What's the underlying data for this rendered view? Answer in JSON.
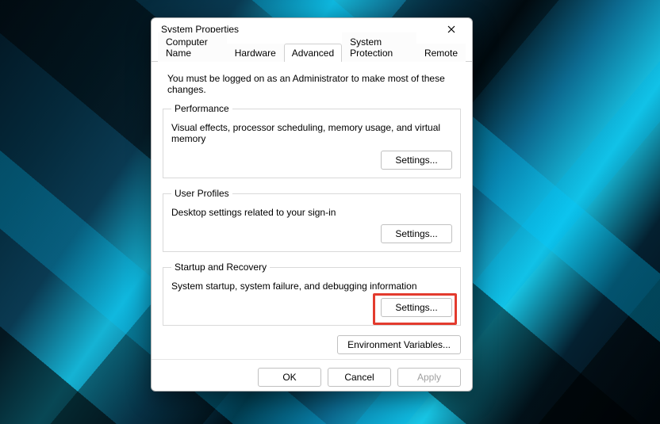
{
  "dialog": {
    "title": "System Properties"
  },
  "tabs": {
    "computer_name": "Computer Name",
    "hardware": "Hardware",
    "advanced": "Advanced",
    "system_protection": "System Protection",
    "remote": "Remote"
  },
  "advanced": {
    "intro": "You must be logged on as an Administrator to make most of these changes.",
    "performance": {
      "legend": "Performance",
      "desc": "Visual effects, processor scheduling, memory usage, and virtual memory",
      "button": "Settings..."
    },
    "user_profiles": {
      "legend": "User Profiles",
      "desc": "Desktop settings related to your sign-in",
      "button": "Settings..."
    },
    "startup_recovery": {
      "legend": "Startup and Recovery",
      "desc": "System startup, system failure, and debugging information",
      "button": "Settings..."
    },
    "env_vars_button": "Environment Variables..."
  },
  "footer": {
    "ok": "OK",
    "cancel": "Cancel",
    "apply": "Apply"
  }
}
